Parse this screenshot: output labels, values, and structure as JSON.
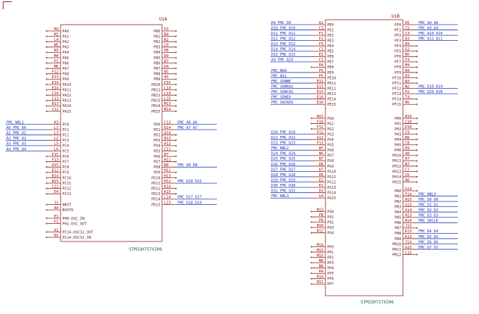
{
  "colors": {
    "body": "#8a2020",
    "pin_name": "#5a1e1e",
    "pin_number": "#a00000",
    "label_text": "#2430b0",
    "wire": "#1838c0",
    "ref_text": "#a00000",
    "value_text": "#1a5a5a",
    "background": "#ffffff"
  },
  "u1a": {
    "ref": "U1A",
    "value": "STM32H757XIH6",
    "left_pins": [
      {
        "name": "PA0",
        "num": "M3",
        "label": ""
      },
      {
        "name": "PA1",
        "num": "M2",
        "label": ""
      },
      {
        "name": "PA2",
        "num": "L4",
        "label": ""
      },
      {
        "name": "PA3",
        "num": "N5",
        "label": ""
      },
      {
        "name": "PA4",
        "num": "N3",
        "label": ""
      },
      {
        "name": "PA5",
        "num": "M4",
        "label": ""
      },
      {
        "name": "PA6",
        "num": "P1",
        "label": ""
      },
      {
        "name": "PA7",
        "num": "M6",
        "label": ""
      },
      {
        "name": "PA8",
        "num": "F12",
        "label": ""
      },
      {
        "name": "PA9",
        "num": "E13",
        "label": ""
      },
      {
        "name": "PA10",
        "num": "E14",
        "label": ""
      },
      {
        "name": "PA11",
        "num": "D14",
        "label": ""
      },
      {
        "name": "PA12",
        "num": "C14",
        "label": ""
      },
      {
        "name": "PA13",
        "num": "C13",
        "label": ""
      },
      {
        "name": "PA14",
        "num": "B13",
        "label": ""
      },
      {
        "name": "PA15",
        "num": "C12",
        "label": ""
      },
      {
        "name": "PC0",
        "num": "K3",
        "label": "FMC_NBL1"
      },
      {
        "name": "PC1",
        "num": "L1",
        "label": "A0_FMC_A0"
      },
      {
        "name": "PC2",
        "num": "L3",
        "label": "A1_FMC_A1"
      },
      {
        "name": "PC3",
        "num": "L2",
        "label": "A2_FMC_A2"
      },
      {
        "name": "PC4",
        "num": "L5",
        "label": "A3_FMC_A3"
      },
      {
        "name": "PC5",
        "num": "L6",
        "label": "A4_FMC_A4"
      },
      {
        "name": "PC6",
        "num": "E15",
        "label": ""
      },
      {
        "name": "PC7",
        "num": "F13",
        "label": ""
      },
      {
        "name": "PC8",
        "num": "D15",
        "label": ""
      },
      {
        "name": "PC9",
        "num": "E12",
        "label": ""
      },
      {
        "name": "PC10",
        "num": "B14",
        "label": ""
      },
      {
        "name": "PC11",
        "num": "B15",
        "label": ""
      },
      {
        "name": "PC12",
        "num": "C11",
        "label": ""
      },
      {
        "name": "PC13",
        "num": "E4",
        "label": ""
      },
      {
        "name": "NRST",
        "num": "J1",
        "label": ""
      },
      {
        "name": "BOOT0",
        "num": "A4",
        "label": ""
      },
      {
        "name": "PH0-OSC_IN",
        "num": "E1",
        "label": ""
      },
      {
        "name": "PH1-OSC_OUT",
        "num": "F1",
        "label": ""
      },
      {
        "name": "PC14-OSC32_OUT",
        "num": "A1",
        "label": ""
      },
      {
        "name": "PC14-OSC32_IN",
        "num": "B1",
        "label": ""
      }
    ],
    "right_pins": [
      {
        "name": "PB0",
        "num": "P3",
        "label": ""
      },
      {
        "name": "PB1",
        "num": "N4",
        "label": ""
      },
      {
        "name": "PB2",
        "num": "R2",
        "label": ""
      },
      {
        "name": "PB3",
        "num": "C9",
        "label": ""
      },
      {
        "name": "PB4",
        "num": "D8",
        "label": ""
      },
      {
        "name": "PB5",
        "num": "D9",
        "label": ""
      },
      {
        "name": "PB6",
        "num": "B7",
        "label": ""
      },
      {
        "name": "PB7",
        "num": "D4",
        "label": ""
      },
      {
        "name": "PB8",
        "num": "B5",
        "label": ""
      },
      {
        "name": "PB9",
        "num": "A5",
        "label": ""
      },
      {
        "name": "PB10",
        "num": "P15",
        "label": ""
      },
      {
        "name": "PB11",
        "num": "L14",
        "label": ""
      },
      {
        "name": "PB12",
        "num": "L13",
        "label": ""
      },
      {
        "name": "PB13",
        "num": "L15",
        "label": ""
      },
      {
        "name": "PB14",
        "num": "M13",
        "label": ""
      },
      {
        "name": "PB15",
        "num": "M14",
        "label": ""
      },
      {
        "name": "PD0",
        "num": "C13",
        "label": "FMC_A6_A6"
      },
      {
        "name": "PD1",
        "num": "D14",
        "label": "FMC_A7_A7"
      },
      {
        "name": "PD2",
        "num": "A14",
        "label": ""
      },
      {
        "name": "PD3",
        "num": "B13",
        "label": ""
      },
      {
        "name": "PD4",
        "num": "A12",
        "label": ""
      },
      {
        "name": "PD5",
        "num": "C11",
        "label": ""
      },
      {
        "name": "PD6",
        "num": "B7",
        "label": ""
      },
      {
        "name": "PD7",
        "num": "H11",
        "label": ""
      },
      {
        "name": "PD8",
        "num": "B8",
        "label": "FMC_D8_D8"
      },
      {
        "name": "PD9",
        "num": "H11",
        "label": ""
      },
      {
        "name": "PD10",
        "num": "H13",
        "label": ""
      },
      {
        "name": "PD11",
        "num": "H12",
        "label": "FMC_D10_D15"
      },
      {
        "name": "PD12",
        "num": "K14",
        "label": ""
      },
      {
        "name": "PD13",
        "num": "K15",
        "label": ""
      },
      {
        "name": "PD14",
        "num": "L14",
        "label": "FMC_D17_D17"
      },
      {
        "name": "PD15",
        "num": "L13",
        "label": "FMC_D18_D19"
      }
    ]
  },
  "u1b": {
    "ref": "U1B",
    "value": "STM32H757XIH6",
    "left_pins": [
      {
        "name": "PE0",
        "num": "A2",
        "label": "D9_FMC_D9"
      },
      {
        "name": "PE1",
        "num": "C3",
        "label": "D10_FMC_D10"
      },
      {
        "name": "PE2",
        "num": "F1",
        "label": "D11_FMC_D11"
      },
      {
        "name": "PE3",
        "num": "F2",
        "label": "D12_FMC_D12"
      },
      {
        "name": "PE4",
        "num": "F3",
        "label": "D13_FMC_D13"
      },
      {
        "name": "PE5",
        "num": "C2",
        "label": "D14_FMC_D14"
      },
      {
        "name": "PE6",
        "num": "E1",
        "label": "D15_FMC_D15"
      },
      {
        "name": "PE7",
        "num": "C1",
        "label": "A4_FMC_A19"
      },
      {
        "name": "PE8",
        "num": "R4",
        "label": ""
      },
      {
        "name": "PE9",
        "num": "P5",
        "label": "FMC_BA0"
      },
      {
        "name": "PE10",
        "num": "P5",
        "label": "FMC_BA1"
      },
      {
        "name": "PE11",
        "num": "E12",
        "label": "FMC_SDNWE"
      },
      {
        "name": "PE12",
        "num": "E11",
        "label": "FMC_SDNRAS"
      },
      {
        "name": "PE13",
        "num": "E13",
        "label": "FMC_SDNCAS"
      },
      {
        "name": "PE14",
        "num": "E14",
        "label": "FMC_SDNE0"
      },
      {
        "name": "PE15",
        "num": "E16",
        "label": "FMC_SDCKE0"
      },
      {
        "name": "PG0",
        "num": "N11",
        "label": ""
      },
      {
        "name": "PG1",
        "num": "F10",
        "label": ""
      },
      {
        "name": "PG2",
        "num": "F11",
        "label": ""
      },
      {
        "name": "PG3",
        "num": "F12",
        "label": "D20_FMC_D20"
      },
      {
        "name": "PG4",
        "num": "G12",
        "label": "D22_FMC_D22"
      },
      {
        "name": "PG5",
        "num": "F13",
        "label": "D23_FMC_D23"
      },
      {
        "name": "PG6",
        "num": "W7",
        "label": "FMC_NBL2"
      },
      {
        "name": "PG7",
        "num": "N6",
        "label": "D24_FMC_D24"
      },
      {
        "name": "PG8",
        "num": "N7",
        "label": "D25_FMC_D25"
      },
      {
        "name": "PG9",
        "num": "D8",
        "label": "D26_FMC_D26"
      },
      {
        "name": "PG10",
        "num": "D7",
        "label": "D27_FMC_D27"
      },
      {
        "name": "PG11",
        "num": "D6",
        "label": "D28_FMC_D28"
      },
      {
        "name": "PG12",
        "num": "E2",
        "label": "D29_FMC_D29"
      },
      {
        "name": "PG13",
        "num": "E1",
        "label": "D30_FMC_D30"
      },
      {
        "name": "PG14",
        "num": "D3",
        "label": "D31_FMC_D31"
      },
      {
        "name": "PG15",
        "num": "G4",
        "label": "FMC_NBL3"
      },
      {
        "name": "PO0",
        "num": "N13",
        "label": ""
      },
      {
        "name": "PO1",
        "num": "P8",
        "label": ""
      },
      {
        "name": "PO2",
        "num": "P8",
        "label": ""
      },
      {
        "name": "PO3",
        "num": "N10",
        "label": ""
      },
      {
        "name": "PO4",
        "num": "R12",
        "label": ""
      },
      {
        "name": "PPO",
        "num": "M14",
        "label": ""
      },
      {
        "name": "PPL",
        "num": "M13",
        "label": ""
      },
      {
        "name": "PP2",
        "num": "M15",
        "label": ""
      },
      {
        "name": "PP3",
        "num": "N8",
        "label": ""
      },
      {
        "name": "PP4",
        "num": "N8",
        "label": ""
      },
      {
        "name": "PP5",
        "num": "R4",
        "label": ""
      },
      {
        "name": "PP6",
        "num": "R14",
        "label": ""
      },
      {
        "name": "PP7",
        "num": "N11",
        "label": ""
      }
    ],
    "right_pins": [
      {
        "name": "PF0",
        "num": "D5",
        "label": "FMC_A0_A0"
      },
      {
        "name": "PF1",
        "num": "C5",
        "label": "FMC_A9_A9"
      },
      {
        "name": "PF2",
        "num": "C4",
        "label": "FMC_A10_A10"
      },
      {
        "name": "PF3",
        "num": "A3",
        "label": "FMC_A11_A11"
      },
      {
        "name": "PF4",
        "num": "B4",
        "label": ""
      },
      {
        "name": "PF5",
        "num": "G2",
        "label": ""
      },
      {
        "name": "PF6",
        "num": "N5",
        "label": ""
      },
      {
        "name": "PF7",
        "num": "F4",
        "label": ""
      },
      {
        "name": "PF8",
        "num": "M4",
        "label": ""
      },
      {
        "name": "PF9",
        "num": "H4",
        "label": ""
      },
      {
        "name": "PF10",
        "num": "R3",
        "label": ""
      },
      {
        "name": "PF11",
        "num": "N3",
        "label": ""
      },
      {
        "name": "PF12",
        "num": "N2",
        "label": "FMC_D19_D19"
      },
      {
        "name": "PF13",
        "num": "P2",
        "label": "FMC_D20_D20"
      },
      {
        "name": "PF14",
        "num": "T4",
        "label": ""
      },
      {
        "name": "PF15",
        "num": "N5",
        "label": ""
      },
      {
        "name": "PH0",
        "num": "B10",
        "label": ""
      },
      {
        "name": "PH1",
        "num": "C10",
        "label": ""
      },
      {
        "name": "PH2",
        "num": "D10",
        "label": ""
      },
      {
        "name": "PH3",
        "num": "C9",
        "label": ""
      },
      {
        "name": "PH4",
        "num": "B8",
        "label": ""
      },
      {
        "name": "PH5",
        "num": "C8",
        "label": ""
      },
      {
        "name": "PH6",
        "num": "D9",
        "label": ""
      },
      {
        "name": "PH10",
        "num": "A8",
        "label": ""
      },
      {
        "name": "PH11",
        "num": "A7",
        "label": ""
      },
      {
        "name": "PH12",
        "num": "B7",
        "label": ""
      },
      {
        "name": "PH13",
        "num": "C7",
        "label": ""
      },
      {
        "name": "PH14",
        "num": "C6",
        "label": ""
      },
      {
        "name": "PH15",
        "num": "A6",
        "label": ""
      },
      {
        "name": "PN0",
        "num": "G14",
        "label": ""
      },
      {
        "name": "PN1",
        "num": "F14",
        "label": "FMC_NBL0"
      },
      {
        "name": "PN2",
        "num": "H15",
        "label": "FMC_D0_D0"
      },
      {
        "name": "PN3",
        "num": "G13",
        "label": "FMC_D1_D1"
      },
      {
        "name": "PN4",
        "num": "G14",
        "label": "FMC_D2_D2"
      },
      {
        "name": "PN5",
        "num": "H13",
        "label": "FMC_D3_D3"
      },
      {
        "name": "PN6",
        "num": "H14",
        "label": "FMC_SDCLK"
      },
      {
        "name": "PN7",
        "num": "J15",
        "label": ""
      },
      {
        "name": "PN8",
        "num": "K13",
        "label": "FMC_D4_D4"
      },
      {
        "name": "PN9",
        "num": "K13",
        "label": "FMC_D5_D5"
      },
      {
        "name": "PN10",
        "num": "J14",
        "label": "FMC_D6_D6"
      },
      {
        "name": "PN11",
        "num": "G15",
        "label": "FMC_D7_D7"
      },
      {
        "name": "PN12",
        "num": "L15",
        "label": ""
      }
    ]
  }
}
